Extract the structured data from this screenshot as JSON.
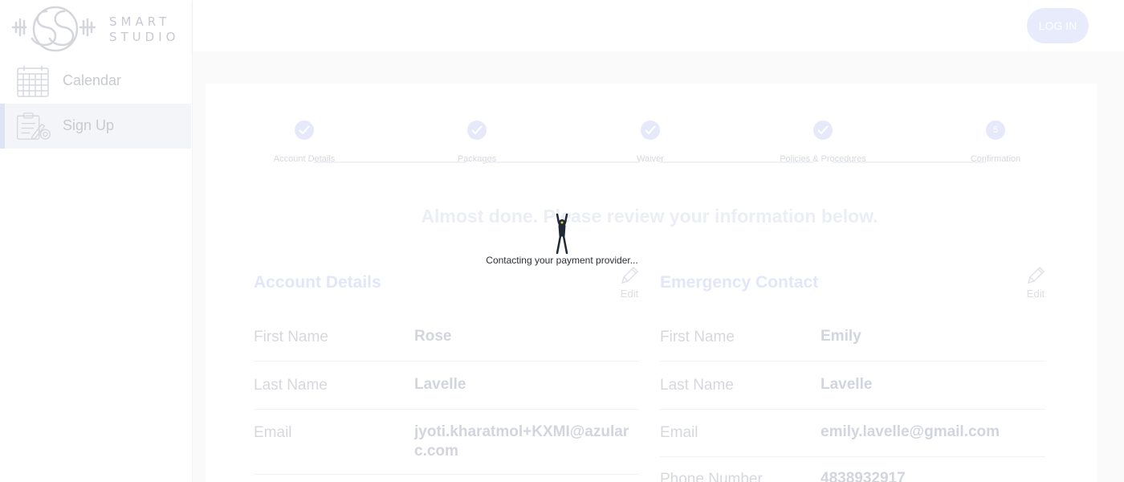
{
  "app": {
    "logo_text_line1": "SMART",
    "logo_text_line2": "STUDIO"
  },
  "sidebar": {
    "items": [
      {
        "label": "Calendar",
        "icon": "calendar-icon",
        "active": false
      },
      {
        "label": "Sign Up",
        "icon": "signup-clipboard-icon",
        "active": true
      }
    ]
  },
  "header": {
    "login_label": "LOG IN"
  },
  "stepper": {
    "steps": [
      {
        "label": "Account Details",
        "state": "done"
      },
      {
        "label": "Packages",
        "state": "done"
      },
      {
        "label": "Waiver",
        "state": "done"
      },
      {
        "label": "Policies & Procedures",
        "state": "done"
      },
      {
        "label": "Confirmation",
        "state": "current",
        "number": "5"
      }
    ]
  },
  "review": {
    "title": "Almost done. Please review your information below."
  },
  "account_details": {
    "title": "Account Details",
    "edit_label": "Edit",
    "rows": [
      {
        "label": "First Name",
        "value": "Rose"
      },
      {
        "label": "Last Name",
        "value": "Lavelle"
      },
      {
        "label": "Email",
        "value": "jyoti.kharatmol+KXMI@azularc.com"
      }
    ]
  },
  "emergency_contact": {
    "title": "Emergency Contact",
    "edit_label": "Edit",
    "rows": [
      {
        "label": "First Name",
        "value": "Emily"
      },
      {
        "label": "Last Name",
        "value": "Lavelle"
      },
      {
        "label": "Email",
        "value": "emily.lavelle@gmail.com"
      },
      {
        "label": "Phone Number",
        "value": "4838932917"
      }
    ]
  },
  "loader": {
    "message": "Contacting your payment provider..."
  },
  "colors": {
    "accent_faded": "#e6e9fa",
    "loader_text": "#2b2f3a",
    "figure": "#1f2a36"
  }
}
